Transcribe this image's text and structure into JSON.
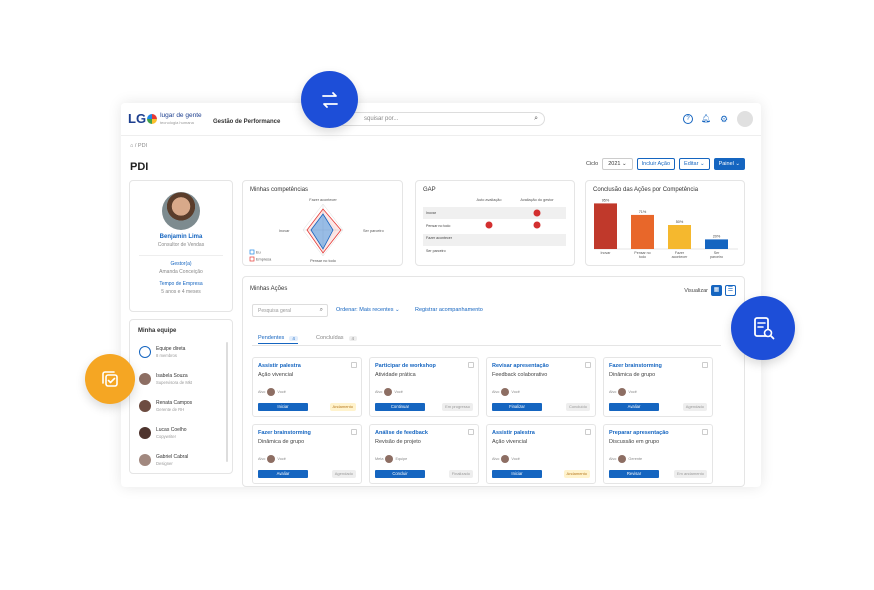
{
  "topbar": {
    "logo_lg": "LG",
    "logo_name": "lugar de gente",
    "logo_sub": "tecnologia humana",
    "module": "Gestão de Performance",
    "search_placeholder": "squisar por..."
  },
  "breadcrumb": "⌂ / PDI",
  "page_title": "PDI",
  "actions": {
    "ciclo_label": "Ciclo",
    "ciclo_value": "2021",
    "incluir": "Incluir Ação",
    "editar": "Editar",
    "painel": "Painel"
  },
  "profile": {
    "name": "Benjamin Lima",
    "role": "Consultor de Vendas",
    "gestor_label": "Gestor(a)",
    "gestor_value": "Amanda Conceição",
    "tempo_label": "Tempo de Empresa",
    "tempo_value": "5 anos e 4 meses"
  },
  "team": {
    "title": "Minha equipe",
    "members": [
      {
        "name": "Equipe direta",
        "role": "8 membros"
      },
      {
        "name": "Isabela Souza",
        "role": "Supervisora de Mkt"
      },
      {
        "name": "Renata Campos",
        "role": "Gerente de RH"
      },
      {
        "name": "Lucas Coelho",
        "role": "Copywriter"
      },
      {
        "name": "Gabriel Cabral",
        "role": "Designer"
      }
    ]
  },
  "radar": {
    "title": "Minhas competências",
    "axes": [
      "Fazer acontecer",
      "Ser parceiro",
      "Pensar no todo",
      "Inovar"
    ],
    "legend": [
      "Eu",
      "Empresa"
    ]
  },
  "gap": {
    "title": "GAP",
    "col1": "Auto avaliação",
    "col2": "Avaliação do gestor",
    "rows": [
      "Inovar",
      "Pensar no todo",
      "Fazer acontecer",
      "Ser parceiro"
    ]
  },
  "chart_data": {
    "type": "bar",
    "title": "Conclusão das Ações por Competência",
    "categories": [
      "Inovar",
      "Pensar no todo",
      "Fazer acontecer",
      "Ser parceiro"
    ],
    "values": [
      95,
      71,
      50,
      20
    ],
    "labels": [
      "95%",
      "71%",
      "50%",
      "20%"
    ],
    "colors": [
      "#c0392b",
      "#e8672a",
      "#f5b82e",
      "#1565c0"
    ],
    "ylim": [
      0,
      100
    ]
  },
  "actions_panel": {
    "title": "Minhas Ações",
    "visualizar": "Visualizar",
    "filter_placeholder": "Pesquisa geral",
    "order": "Ordenar: Mais recentes",
    "register": "Registrar acompanhamento",
    "tab_pending": "Pendentes",
    "tab_pending_count": "4",
    "tab_done": "Concluídas",
    "tab_done_count": "4"
  },
  "cards": [
    {
      "title": "Assistir palestra",
      "sub": "Ação vivencial",
      "tag": "Alvo",
      "owner": "Você",
      "button": "Iniciar",
      "status": "Andamento",
      "yellow": true
    },
    {
      "title": "Participar de workshop",
      "sub": "Atividade prática",
      "tag": "Alvo",
      "owner": "Você",
      "button": "Continuar",
      "status": "Em progresso",
      "yellow": false
    },
    {
      "title": "Revisar apresentação",
      "sub": "Feedback colaborativo",
      "tag": "Alvo",
      "owner": "Você",
      "button": "Finalizar",
      "status": "Concluído",
      "yellow": false
    },
    {
      "title": "Fazer brainstorming",
      "sub": "Dinâmica de grupo",
      "tag": "Alvo",
      "owner": "Você",
      "button": "Avaliar",
      "status": "Agendado",
      "yellow": false
    },
    {
      "title": "Fazer brainstorming",
      "sub": "Dinâmica de grupo",
      "tag": "Alvo",
      "owner": "Você",
      "button": "Avaliar",
      "status": "Agendado",
      "yellow": false
    },
    {
      "title": "Análise de feedback",
      "sub": "Revisão de projeto",
      "tag": "Meta",
      "owner": "Equipe",
      "button": "Concluir",
      "status": "Finalizado",
      "yellow": false
    },
    {
      "title": "Assistir palestra",
      "sub": "Ação vivencial",
      "tag": "Alvo",
      "owner": "Você",
      "button": "Iniciar",
      "status": "Andamento",
      "yellow": true
    },
    {
      "title": "Preparar apresentação",
      "sub": "Discussão em grupo",
      "tag": "Alvo",
      "owner": "Gerente",
      "button": "Revisar",
      "status": "Em andamento",
      "yellow": false
    }
  ]
}
